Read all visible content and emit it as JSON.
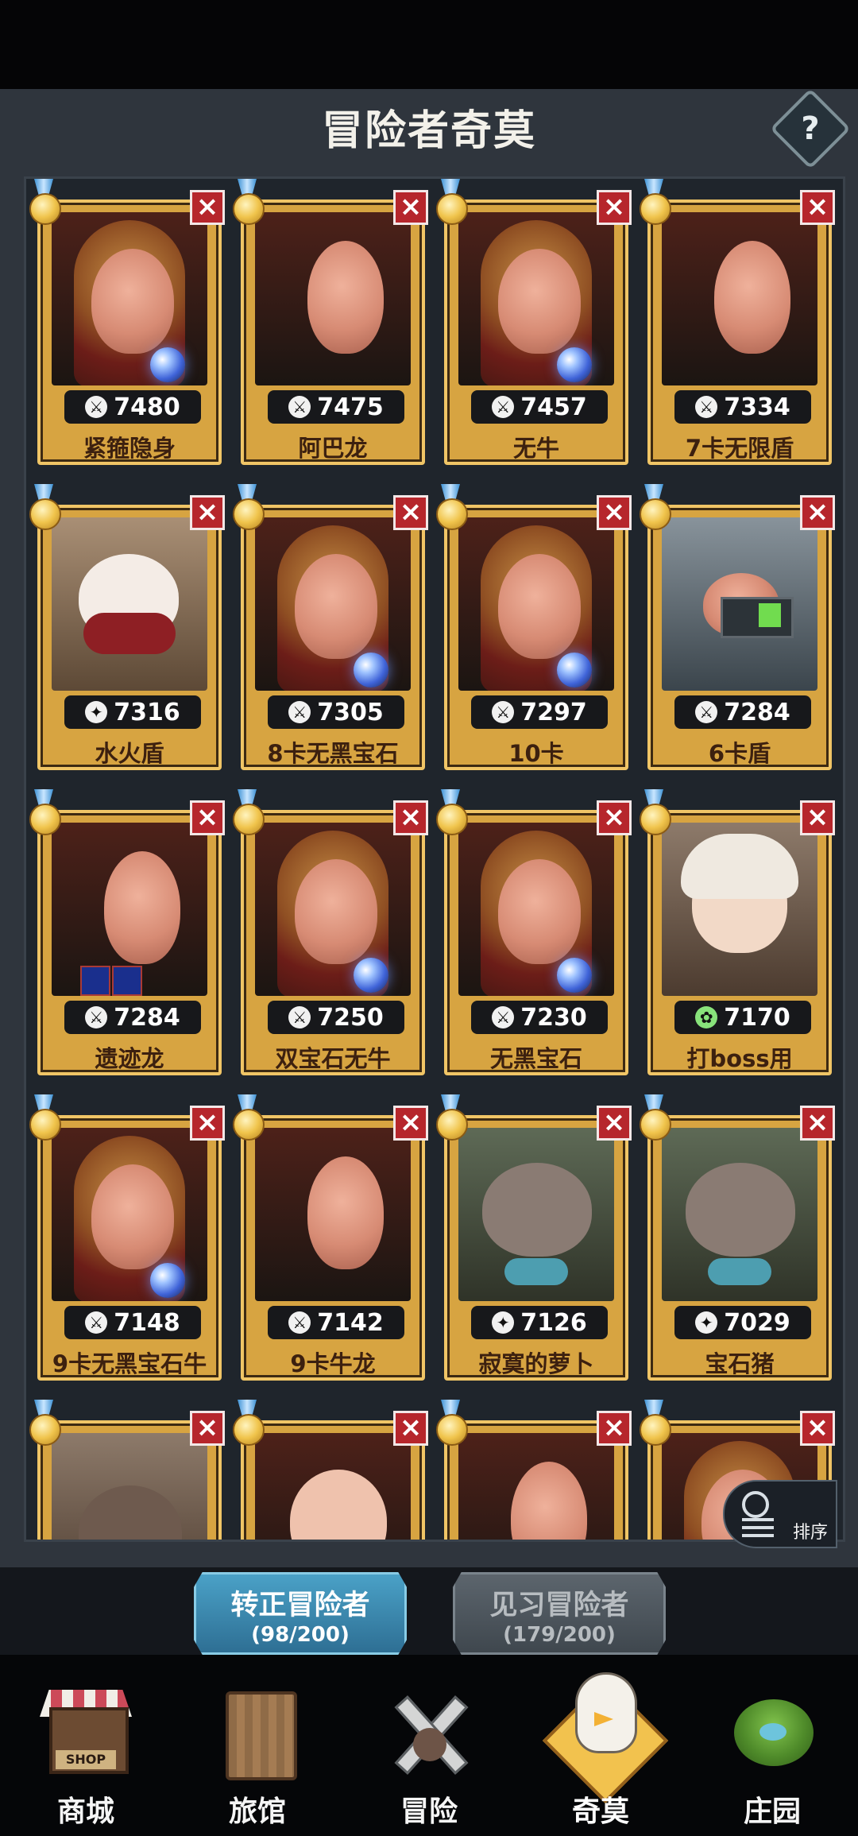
{
  "header": {
    "title": "冒险者奇莫",
    "help_label": "?"
  },
  "cards": [
    {
      "score": "7480",
      "name": "紧箍隐身",
      "close": "×"
    },
    {
      "score": "7475",
      "name": "阿巴龙",
      "close": "×"
    },
    {
      "score": "7457",
      "name": "无牛",
      "close": "×"
    },
    {
      "score": "7334",
      "name": "7卡无限盾",
      "close": "×"
    },
    {
      "score": "7316",
      "name": "水火盾",
      "close": "×"
    },
    {
      "score": "7305",
      "name": "8卡无黑宝石",
      "close": "×"
    },
    {
      "score": "7297",
      "name": "10卡",
      "close": "×"
    },
    {
      "score": "7284",
      "name": "6卡盾",
      "close": "×"
    },
    {
      "score": "7284",
      "name": "遗迹龙",
      "close": "×"
    },
    {
      "score": "7250",
      "name": "双宝石无牛",
      "close": "×"
    },
    {
      "score": "7230",
      "name": "无黑宝石",
      "close": "×"
    },
    {
      "score": "7170",
      "name": "打boss用",
      "close": "×"
    },
    {
      "score": "7148",
      "name": "9卡无黑宝石牛",
      "close": "×"
    },
    {
      "score": "7142",
      "name": "9卡牛龙",
      "close": "×"
    },
    {
      "score": "7126",
      "name": "寂寞的萝卜",
      "close": "×"
    },
    {
      "score": "7029",
      "name": "宝石猪",
      "close": "×"
    },
    {
      "score": "",
      "name": "",
      "close": "×"
    },
    {
      "score": "",
      "name": "",
      "close": "×"
    },
    {
      "score": "",
      "name": "",
      "close": "×"
    },
    {
      "score": "",
      "name": "",
      "close": "×"
    }
  ],
  "sort": {
    "label": "排序"
  },
  "tabs": {
    "formal": {
      "label": "转正冒险者",
      "count": "(98/200)"
    },
    "trainee": {
      "label": "见习冒险者",
      "count": "(179/200)"
    }
  },
  "nav": {
    "shop": {
      "label": "商城",
      "sign": "SHOP"
    },
    "inn": {
      "label": "旅馆"
    },
    "adventure": {
      "label": "冒险"
    },
    "qimo": {
      "label": "奇莫"
    },
    "farm": {
      "label": "庄园"
    }
  }
}
